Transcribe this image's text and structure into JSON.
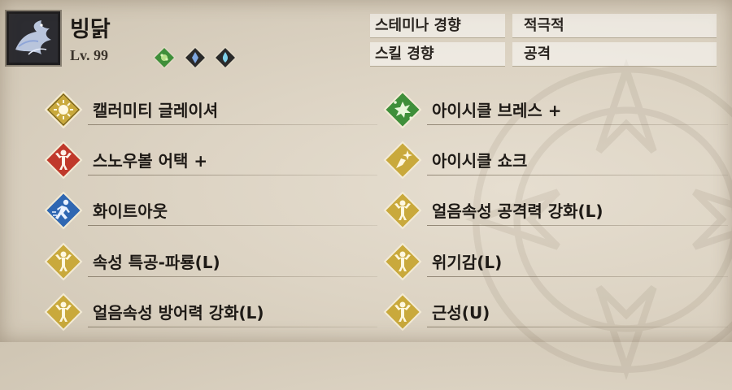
{
  "monster": {
    "name": "빙닭",
    "level": "Lv. 99",
    "portrait_icon": "ice-bird-icon",
    "elements": [
      {
        "icon": "nature-element-icon",
        "color": "#3f8f3a"
      },
      {
        "icon": "ice-element-icon",
        "color": "#2a2a2a"
      },
      {
        "icon": "water-element-icon",
        "color": "#2a2a2a"
      }
    ]
  },
  "tendencies": [
    {
      "label": "스테미나 경향",
      "value": "적극적"
    },
    {
      "label": "스킬 경향",
      "value": "공격"
    }
  ],
  "skills": [
    {
      "name": "캘러미티 글레이셔",
      "icon": "burst-star-icon",
      "color": "#c9a93c"
    },
    {
      "name": "아이시클 브레스 +",
      "icon": "splash-icon",
      "color": "#3f8f3a"
    },
    {
      "name": "스노우볼 어택 +",
      "icon": "strength-figure-icon",
      "color": "#c0392b"
    },
    {
      "name": "아이시클 쇼크",
      "icon": "sparkle-claw-icon",
      "color": "#c9a93c"
    },
    {
      "name": "화이트아웃",
      "icon": "running-figure-icon",
      "color": "#2f67b2"
    },
    {
      "name": "얼음속성 공격력 강화(L)",
      "icon": "strength-figure-icon",
      "color": "#c9a93c"
    },
    {
      "name": "속성 특공-파룡(L)",
      "icon": "strength-figure-icon",
      "color": "#c9a93c"
    },
    {
      "name": "위기감(L)",
      "icon": "strength-figure-icon",
      "color": "#c9a93c"
    },
    {
      "name": "얼음속성 방어력 강화(L)",
      "icon": "strength-figure-icon",
      "color": "#c9a93c"
    },
    {
      "name": "근성(U)",
      "icon": "strength-figure-icon",
      "color": "#c9a93c"
    }
  ]
}
